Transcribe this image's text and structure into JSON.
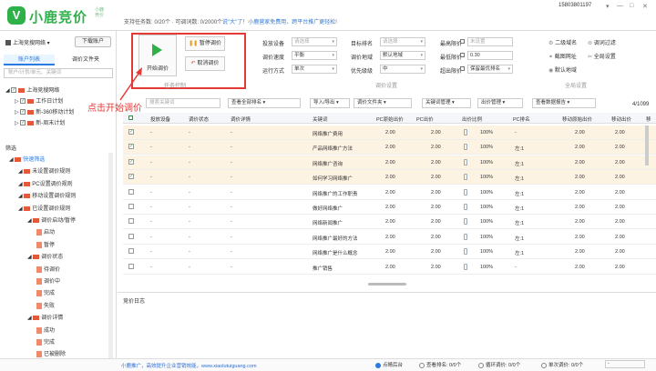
{
  "app": {
    "name": "小鹿竞价",
    "name_sub": "小鹿竞价"
  },
  "topbar": {
    "task_count_text": "支持任务数: 0/20个 · 可调词数: 0/2000个",
    "promo_text": "说\"大\"了！小鹿营家免费用，跨平台推广更轻松!",
    "account": "15803801197",
    "window_controls": [
      "▾",
      "—",
      "□",
      "✕"
    ]
  },
  "sidebar": {
    "user": "上海竞搜网络",
    "download_button": "下载账户",
    "tabs": [
      "账户列表",
      "调价文件夹"
    ],
    "search_placeholder": "账户/计划/单元、关键词",
    "tree": [
      {
        "label": "上海竞搜网络",
        "checked": true,
        "level": 0
      },
      {
        "label": "工作日计划",
        "checked": true,
        "level": 1
      },
      {
        "label": "新-360移动计划",
        "checked": true,
        "level": 1
      },
      {
        "label": "新-周末计划",
        "checked": true,
        "level": 1
      }
    ],
    "filter_label": "筛选",
    "filter_tree": [
      {
        "label": "快速筛选",
        "level": 0,
        "active": true
      },
      {
        "label": "未设置调价规则",
        "level": 1
      },
      {
        "label": "PC设置调价规则",
        "level": 1
      },
      {
        "label": "移动设置调价规则",
        "level": 1
      },
      {
        "label": "已设置调价规则",
        "level": 1
      },
      {
        "label": "调价启动/暂停",
        "level": 2
      },
      {
        "label": "启动",
        "level": 3
      },
      {
        "label": "暂停",
        "level": 3
      },
      {
        "label": "调价状态",
        "level": 2
      },
      {
        "label": "待调价",
        "level": 3
      },
      {
        "label": "调价中",
        "level": 3
      },
      {
        "label": "完成",
        "level": 3
      },
      {
        "label": "失败",
        "level": 3
      },
      {
        "label": "调价详情",
        "level": 2
      },
      {
        "label": "成功",
        "level": 3
      },
      {
        "label": "完成",
        "level": 3
      },
      {
        "label": "已被删除",
        "level": 3
      }
    ]
  },
  "control": {
    "start_button": "开始调价",
    "pause_button": "暂停调价",
    "cancel_button": "取消调价",
    "section_task": "任务控制",
    "section_settings": "调价设置",
    "section_global": "全局设置",
    "settings": {
      "device_label": "投放设备",
      "device_value": "请选择",
      "speed_label": "调价速度",
      "speed_value": "平衡",
      "mode_label": "运行方式",
      "mode_value": "单次",
      "target_rank_label": "目标排名",
      "target_rank_value": "请选择",
      "region_label": "调价地域",
      "region_value": "默认地域",
      "priority_label": "优先级级",
      "priority_value": "中",
      "max_price_label": "最高限价",
      "max_price_value": "未设置",
      "min_price_label": "最低限价",
      "min_price_value": "0.30",
      "over_limit_label": "超出限价",
      "over_limit_value": "保留最优排名"
    },
    "global": [
      "二级域名",
      "调词过滤",
      "截图网址",
      "全局设置",
      "默认地域"
    ]
  },
  "toolbar": {
    "search_placeholder": "搜索关键词",
    "buttons": [
      "查看全部排名",
      "导入/导出",
      "调价文件夹",
      "关键词管理",
      "出价管理",
      "查看数据报告"
    ],
    "pager": "4/1099"
  },
  "table": {
    "headers": [
      "投放设备",
      "调价状态",
      "调价详情",
      "关键词",
      "PC原始出价",
      "PC出价",
      "出价比例",
      "PC排名",
      "移动原始出价",
      "移动出价",
      "移"
    ],
    "rows": [
      {
        "checked": true,
        "device": "-",
        "status": "-",
        "detail": "-",
        "keyword": "网络推广费用",
        "pc_orig": "2.00",
        "pc_bid": "2.00",
        "ratio": "100%",
        "pc_rank": "-",
        "m_orig": "2.00",
        "m_bid": "2.00",
        "hl": true
      },
      {
        "checked": true,
        "device": "-",
        "status": "-",
        "detail": "-",
        "keyword": "产品网络推广方法",
        "pc_orig": "2.00",
        "pc_bid": "2.00",
        "ratio": "100%",
        "pc_rank": "左:1",
        "m_orig": "2.00",
        "m_bid": "2.00",
        "hl": true
      },
      {
        "checked": true,
        "device": "-",
        "status": "-",
        "detail": "-",
        "keyword": "网络推广咨询",
        "pc_orig": "2.00",
        "pc_bid": "2.00",
        "ratio": "100%",
        "pc_rank": "左:1",
        "m_orig": "2.00",
        "m_bid": "2.00",
        "hl": true
      },
      {
        "checked": true,
        "device": "-",
        "status": "-",
        "detail": "-",
        "keyword": "如何学习网络推广",
        "pc_orig": "2.00",
        "pc_bid": "2.00",
        "ratio": "100%",
        "pc_rank": "左:1",
        "m_orig": "2.00",
        "m_bid": "2.00",
        "hl": true
      },
      {
        "checked": false,
        "device": "-",
        "status": "-",
        "detail": "-",
        "keyword": "网络推广的工作职责",
        "pc_orig": "2.00",
        "pc_bid": "2.00",
        "ratio": "100%",
        "pc_rank": "左:1",
        "m_orig": "2.00",
        "m_bid": "2.00",
        "hl": false
      },
      {
        "checked": false,
        "device": "-",
        "status": "-",
        "detail": "-",
        "keyword": "做好网络推广",
        "pc_orig": "2.00",
        "pc_bid": "2.00",
        "ratio": "100%",
        "pc_rank": "左:1",
        "m_orig": "2.00",
        "m_bid": "2.00",
        "hl": false
      },
      {
        "checked": false,
        "device": "-",
        "status": "-",
        "detail": "-",
        "keyword": "网络新闻推广",
        "pc_orig": "2.00",
        "pc_bid": "2.00",
        "ratio": "100%",
        "pc_rank": "左:1",
        "m_orig": "2.00",
        "m_bid": "2.00",
        "hl": false
      },
      {
        "checked": false,
        "device": "-",
        "status": "-",
        "detail": "-",
        "keyword": "网络推广最好的方法",
        "pc_orig": "2.00",
        "pc_bid": "2.00",
        "ratio": "100%",
        "pc_rank": "左:1",
        "m_orig": "2.00",
        "m_bid": "2.00",
        "hl": false
      },
      {
        "checked": false,
        "device": "-",
        "status": "-",
        "detail": "-",
        "keyword": "网络推广是什么概念",
        "pc_orig": "2.00",
        "pc_bid": "2.00",
        "ratio": "100%",
        "pc_rank": "左:1",
        "m_orig": "2.00",
        "m_bid": "2.00",
        "hl": false
      },
      {
        "checked": false,
        "device": "-",
        "status": "-",
        "detail": "-",
        "keyword": "推广销售",
        "pc_orig": "2.00",
        "pc_bid": "2.00",
        "ratio": "100%",
        "pc_rank": "-",
        "m_orig": "2.00",
        "m_bid": "2.00",
        "hl": false
      }
    ]
  },
  "log": {
    "label": "竞价日志"
  },
  "footer": {
    "link": "小鹿推广，高效提升企业营销效能，www.xiaolutuiguang.com",
    "items": [
      "点睛后台",
      "查看排名: 0/0个",
      "循环调价: 0/0个",
      "单次调价: 0/0个"
    ],
    "count_placeholder": "-"
  },
  "annotation": "点击开始调价",
  "colors": {
    "brand": "#2fb14a",
    "accent": "#2a7be0",
    "highlight": "#e53935"
  }
}
